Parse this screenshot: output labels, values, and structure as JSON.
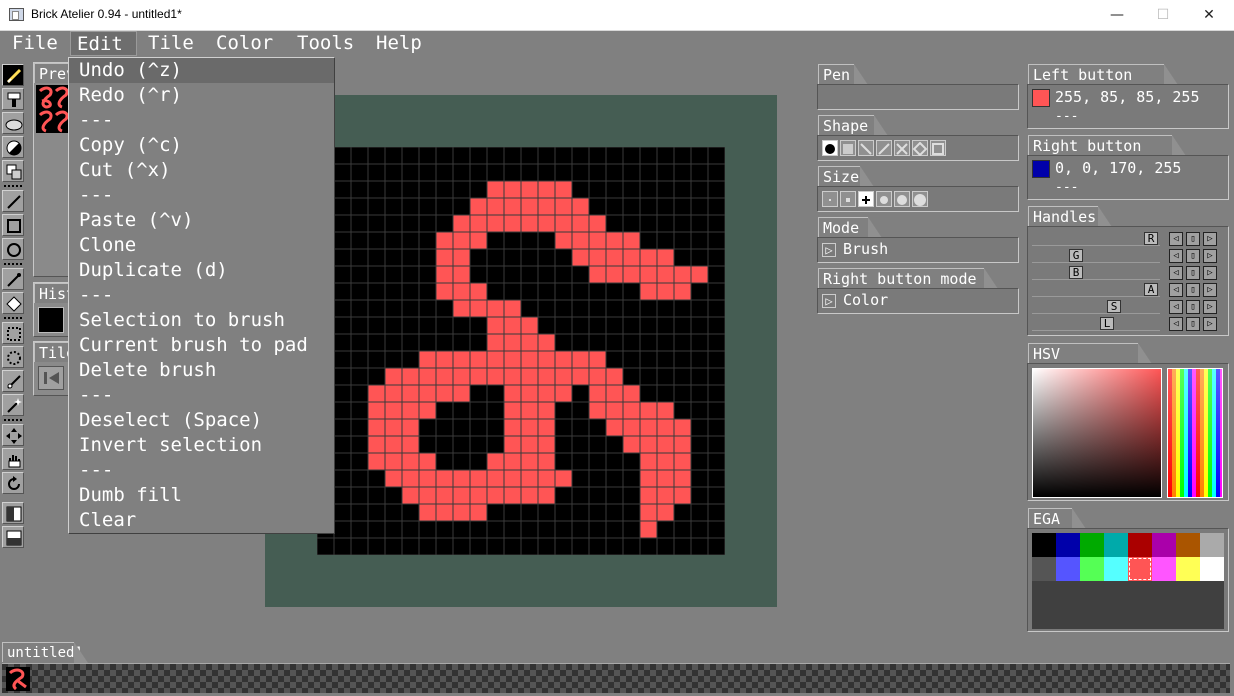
{
  "window": {
    "title": "Brick Atelier 0.94 - untitled1*",
    "minimize": "—",
    "maximize": "☐",
    "close": "✕"
  },
  "menubar": {
    "items": [
      "File",
      "Edit",
      "Tile",
      "Color",
      "Tools",
      "Help"
    ],
    "active": "Edit"
  },
  "edit_menu": {
    "items": [
      "Undo (^z)",
      "Redo (^r)",
      "---",
      "Copy (^c)",
      "Cut (^x)",
      "---",
      "Paste (^v)",
      "Clone",
      "Duplicate (d)",
      "---",
      "Selection to brush",
      "Current brush to pad",
      "Delete brush",
      "---",
      "Deselect (Space)",
      "Invert selection",
      "---",
      "Dumb fill",
      "Clear"
    ],
    "highlighted": "Undo (^z)"
  },
  "left_panels": {
    "preview": "Prev",
    "history": "Hist",
    "tiles": "Tiles"
  },
  "right_panels": {
    "pen": {
      "label": "Pen"
    },
    "shape": {
      "label": "Shape"
    },
    "size": {
      "label": "Size"
    },
    "mode": {
      "label": "Mode",
      "value": "Brush"
    },
    "right_button_mode": {
      "label": "Right button mode",
      "value": "Color"
    },
    "left_button_color": {
      "label": "Left button color",
      "value": "255, 85, 85, 255",
      "extra": "---",
      "swatch": "#ff5555"
    },
    "right_button_color": {
      "label": "Right button color",
      "value": "0, 0, 170, 255",
      "extra": "---",
      "swatch": "#0000aa"
    },
    "handles": {
      "label": "Handles",
      "sliders": [
        {
          "name": "R",
          "value": 1.0
        },
        {
          "name": "G",
          "value": 0.33
        },
        {
          "name": "B",
          "value": 0.33
        },
        {
          "name": "A",
          "value": 1.0
        },
        {
          "name": "S",
          "value": 0.67
        },
        {
          "name": "L",
          "value": 0.61
        }
      ]
    },
    "hsv_selector": {
      "label": "HSV Selector"
    },
    "palette": {
      "label": "EGA",
      "colors": [
        "#000000",
        "#0000aa",
        "#00aa00",
        "#00aaaa",
        "#aa0000",
        "#aa00aa",
        "#aa5500",
        "#aaaaaa",
        "#555555",
        "#5555ff",
        "#55ff55",
        "#55ffff",
        "#ff5555",
        "#ff55ff",
        "#ffff55",
        "#ffffff"
      ]
    }
  },
  "document_tab": {
    "label": "untitled1"
  },
  "canvas": {
    "grid": 24,
    "color": "#ff5555",
    "background": "#000000",
    "border_color": "#455d53",
    "rows": [
      "........................",
      "........................",
      "..........#####.........",
      ".........#######........",
      "........#########.......",
      ".......###....#####.....",
      ".......##......######...",
      ".......##.......#######.",
      ".......###.........###..",
      "........####............",
      "..........###...........",
      "..........####..........",
      "......###########.......",
      "....##############......",
      "...######..####.###.....",
      "...####....###..#####...",
      "...###.....###...#####..",
      "...###.....###....####..",
      "...####...####.....###..",
      "....###########....###..",
      ".....#########.....###..",
      "......####.........##...",
      "...................#....",
      "........................"
    ]
  }
}
